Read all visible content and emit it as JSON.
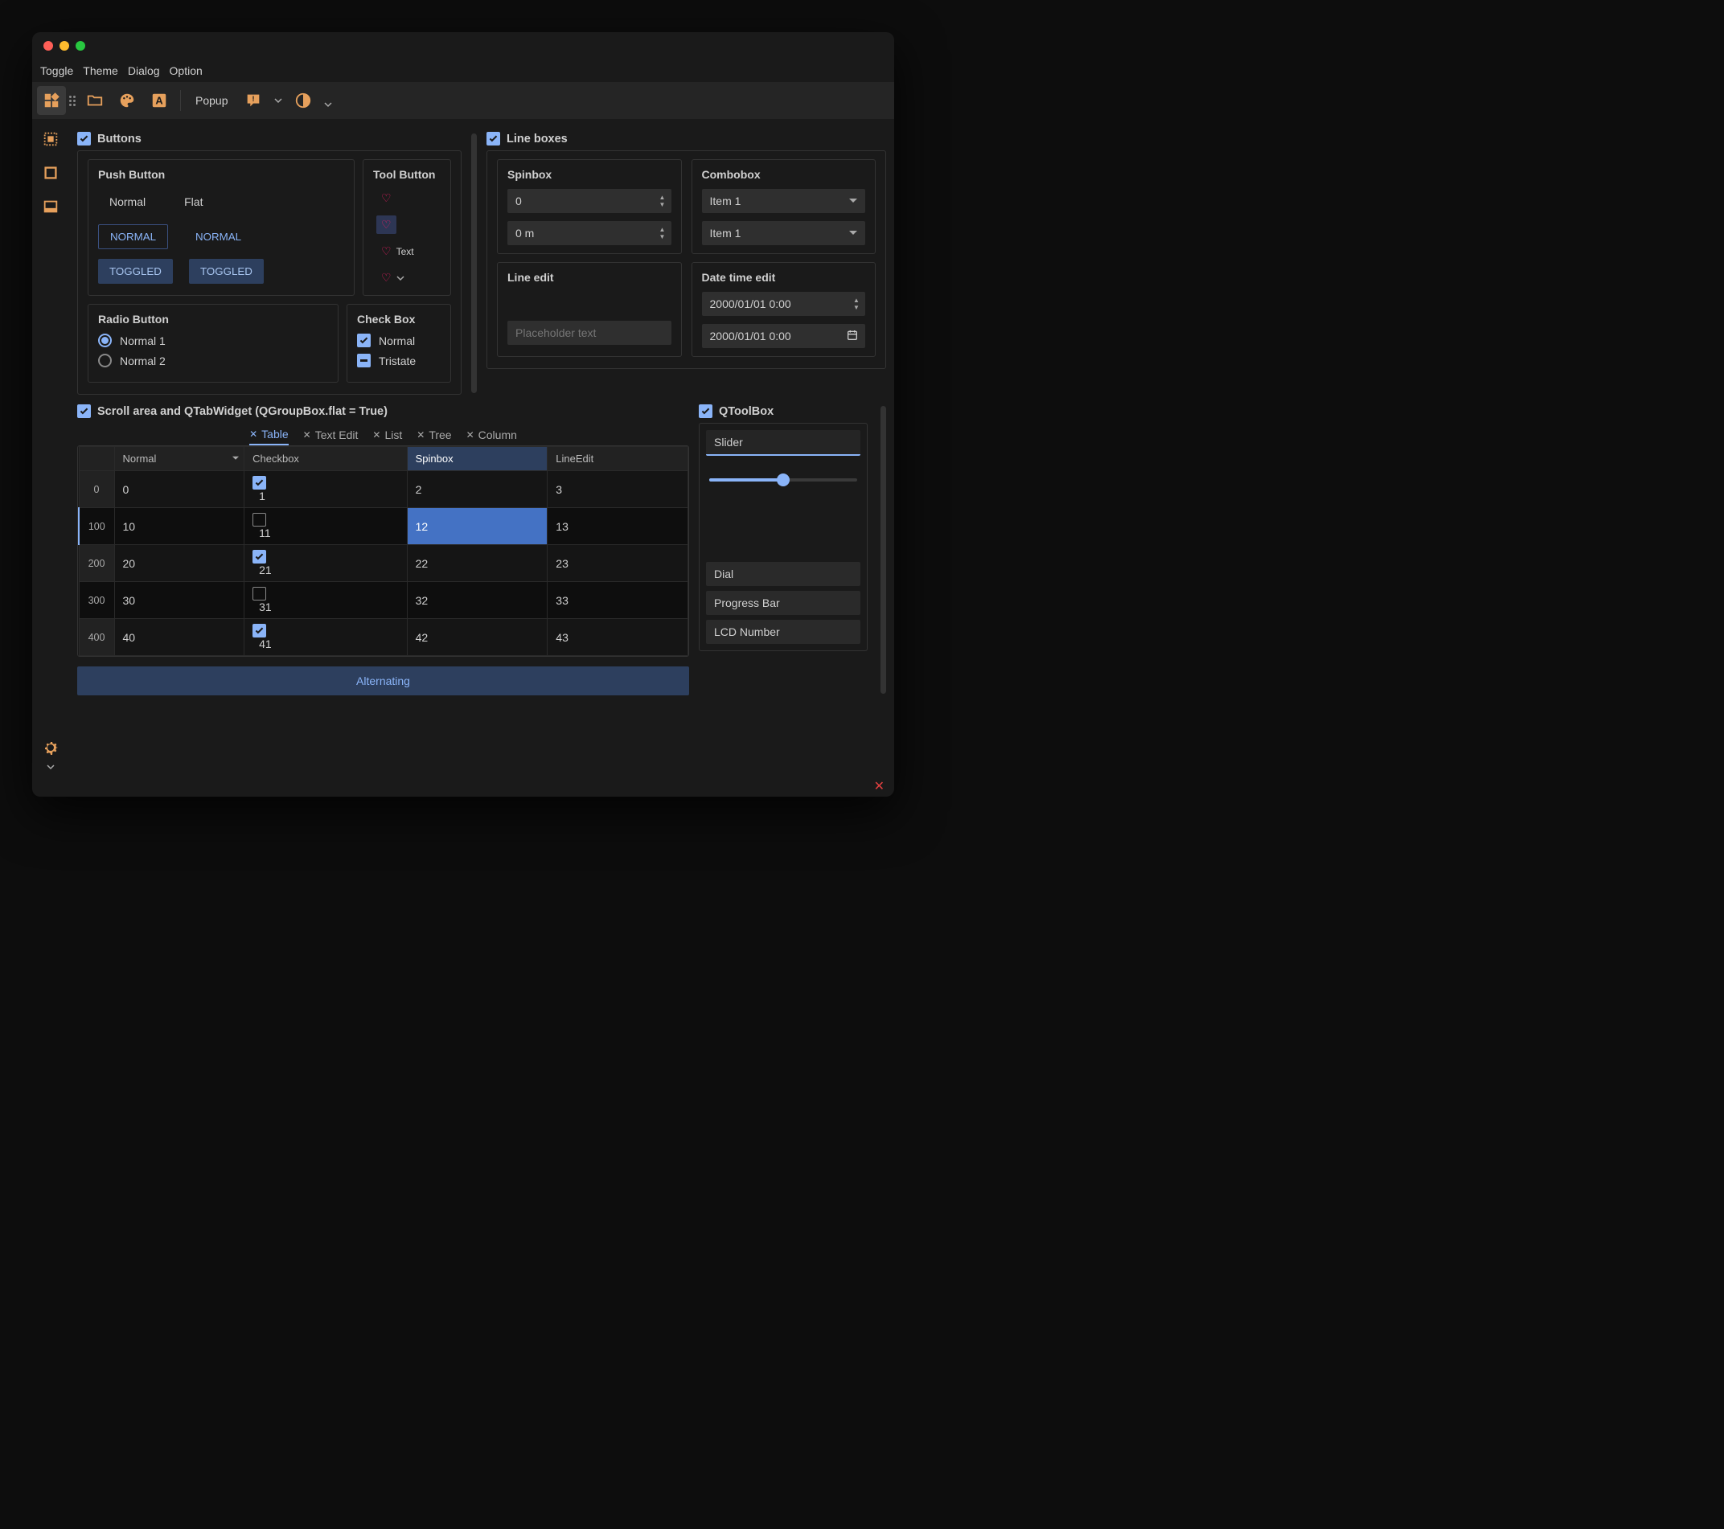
{
  "menubar": {
    "items": [
      "Toggle",
      "Theme",
      "Dialog",
      "Option"
    ]
  },
  "toolbar": {
    "popup_label": "Popup"
  },
  "groups": {
    "buttons": {
      "title": "Buttons",
      "push": {
        "title": "Push Button",
        "normal": "Normal",
        "flat": "Flat",
        "normal_upper": "NORMAL",
        "toggled": "TOGGLED"
      },
      "tool": {
        "title": "Tool Button",
        "text_label": "Text"
      },
      "radio": {
        "title": "Radio Button",
        "opt1": "Normal 1",
        "opt2": "Normal 2"
      },
      "checkbox": {
        "title": "Check Box",
        "normal": "Normal",
        "tristate": "Tristate"
      }
    },
    "lineboxes": {
      "title": "Line boxes",
      "spinbox": {
        "title": "Spinbox",
        "val1": "0",
        "val2": "0 m"
      },
      "combobox": {
        "title": "Combobox",
        "val1": "Item 1",
        "val2": "Item 1"
      },
      "lineedit": {
        "title": "Line edit",
        "placeholder": "Placeholder text"
      },
      "datetime": {
        "title": "Date time edit",
        "val1": "2000/01/01 0:00",
        "val2": "2000/01/01 0:00"
      }
    },
    "scroll": {
      "title": "Scroll area and QTabWidget (QGroupBox.flat = True)",
      "tabs": [
        "Table",
        "Text Edit",
        "List",
        "Tree",
        "Column"
      ],
      "table": {
        "headers": [
          "Normal",
          "Checkbox",
          "Spinbox",
          "LineEdit"
        ],
        "row_headers": [
          "0",
          "100",
          "200",
          "300",
          "400"
        ],
        "rows": [
          {
            "c0": "0",
            "c1_checked": true,
            "c1": "1",
            "c2": "2",
            "c3": "3"
          },
          {
            "c0": "10",
            "c1_checked": false,
            "c1": "11",
            "c2": "12",
            "c3": "13"
          },
          {
            "c0": "20",
            "c1_checked": true,
            "c1": "21",
            "c2": "22",
            "c3": "23"
          },
          {
            "c0": "30",
            "c1_checked": false,
            "c1": "31",
            "c2": "32",
            "c3": "33"
          },
          {
            "c0": "40",
            "c1_checked": true,
            "c1": "41",
            "c2": "42",
            "c3": "43"
          }
        ],
        "selected_cell": {
          "row": 1,
          "col": 2
        }
      },
      "alternating_btn": "Alternating"
    },
    "toolbox": {
      "title": "QToolBox",
      "items": [
        "Slider",
        "Dial",
        "Progress Bar",
        "LCD Number"
      ],
      "slider_value_pct": 50
    }
  }
}
